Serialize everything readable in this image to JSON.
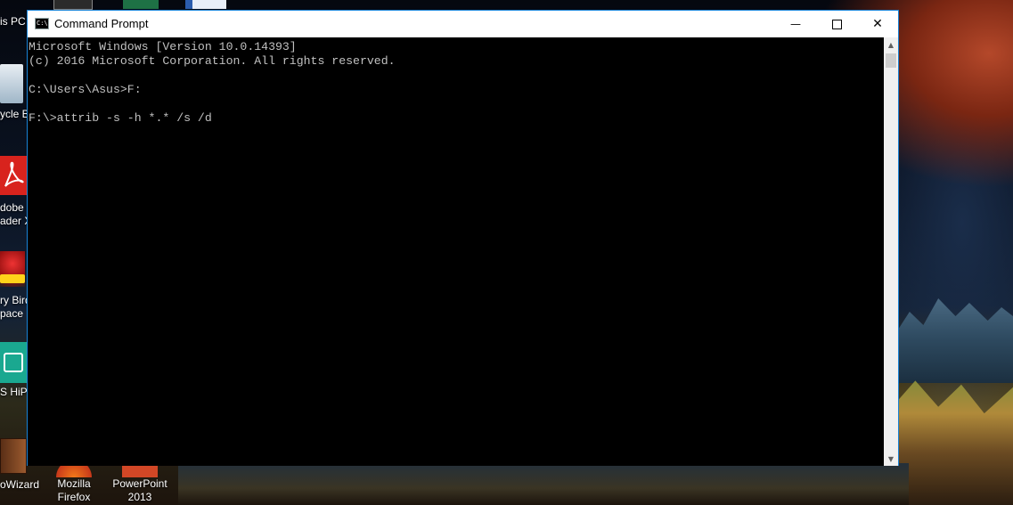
{
  "desktop": {
    "left_icons": [
      {
        "label": "is PC",
        "icon": "this-pc-icon"
      },
      {
        "label": "ycle Bi",
        "icon": "recycle-bin-icon"
      },
      {
        "label": "dobe",
        "label2": "ader X",
        "icon": "adobe-reader-icon"
      },
      {
        "label": "ry Bird",
        "label2": "pace",
        "icon": "angry-birds-space-icon"
      },
      {
        "label": "S HiPc",
        "icon": "hipc-icon"
      },
      {
        "label": "oWizard",
        "icon": "wizard-icon"
      }
    ],
    "bottom_icons": [
      {
        "label": "Mozilla",
        "label2": "Firefox",
        "icon": "firefox-icon"
      },
      {
        "label": "PowerPoint",
        "label2": "2013",
        "icon": "powerpoint-icon"
      }
    ]
  },
  "window": {
    "title": "Command Prompt",
    "icon": "cmd-icon",
    "minimize_glyph": "—",
    "maximize_glyph": "☐",
    "close_glyph": "✕"
  },
  "console": {
    "lines": [
      "Microsoft Windows [Version 10.0.14393]",
      "(c) 2016 Microsoft Corporation. All rights reserved.",
      "",
      "C:\\Users\\Asus>F:",
      "",
      "F:\\>attrib -s -h *.* /s /d"
    ]
  },
  "scrollbar": {
    "up_glyph": "▲",
    "down_glyph": "▼"
  },
  "colors": {
    "console_bg": "#000000",
    "console_text": "#c0c0c0",
    "window_border": "#1883d7"
  }
}
